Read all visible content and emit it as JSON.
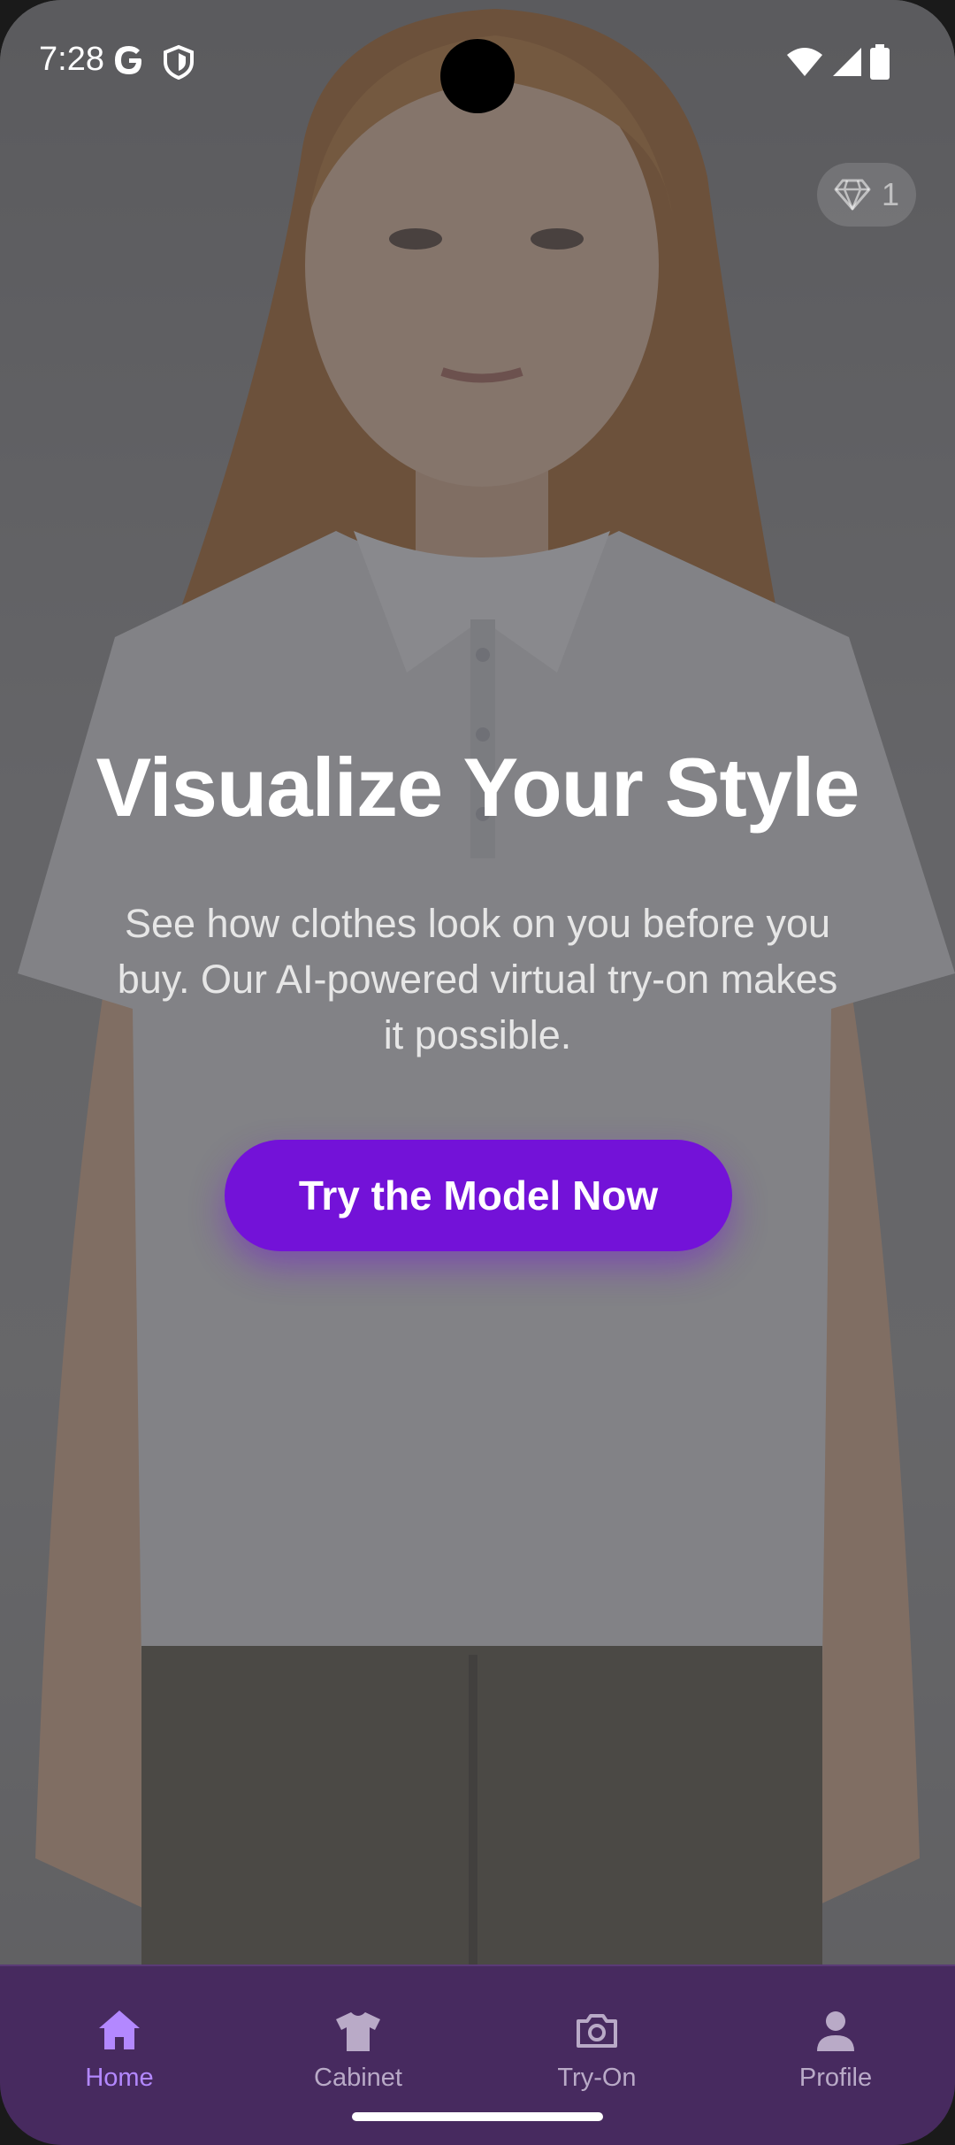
{
  "status_bar": {
    "time": "7:28"
  },
  "credits": {
    "icon": "diamond-icon",
    "count": "1"
  },
  "hero": {
    "title": "Visualize Your Style",
    "subtitle": "See how clothes look on you before you buy. Our AI-powered virtual try-on makes it possible.",
    "cta_label": "Try the Model Now"
  },
  "bottom_nav": {
    "items": [
      {
        "label": "Home",
        "icon": "home-icon",
        "active": true
      },
      {
        "label": "Cabinet",
        "icon": "shirt-icon",
        "active": false
      },
      {
        "label": "Try-On",
        "icon": "camera-icon",
        "active": false
      },
      {
        "label": "Profile",
        "icon": "person-icon",
        "active": false
      }
    ]
  },
  "colors": {
    "accent": "#7312d8",
    "nav_background": "#472a5f",
    "nav_active": "#b388ff",
    "nav_inactive": "#b9aac7"
  }
}
